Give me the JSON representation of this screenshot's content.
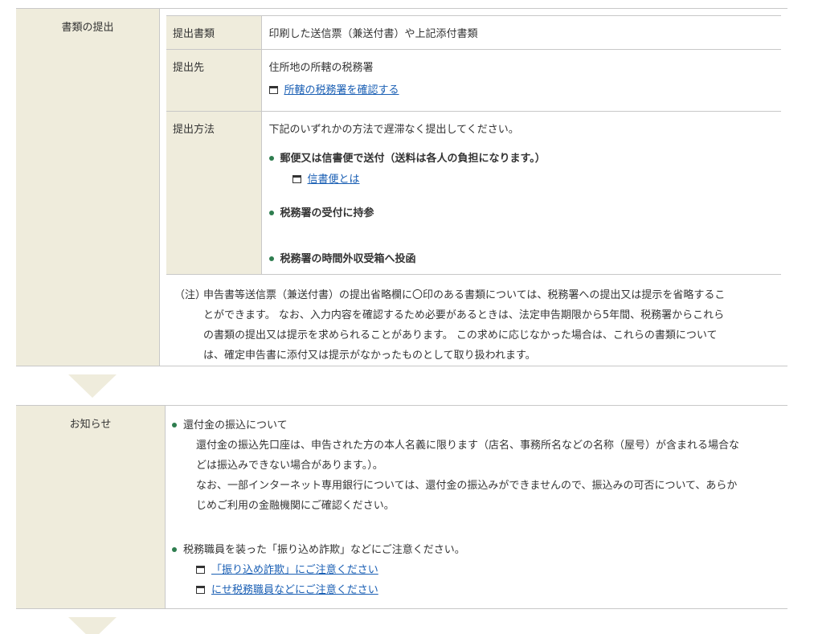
{
  "submission": {
    "heading": "書類の提出",
    "rows": {
      "documents": {
        "label": "提出書類",
        "value": "印刷した送信票（兼送付書）や上記添付書類"
      },
      "destination": {
        "label": "提出先",
        "value": "住所地の所轄の税務署",
        "link": "所轄の税務署を確認する"
      },
      "method": {
        "label": "提出方法",
        "intro": "下記のいずれかの方法で遅滞なく提出してください。",
        "options": [
          {
            "text": "郵便又は信書便で送付（送料は各人の負担になります。）",
            "link": "信書便とは"
          },
          {
            "text": "税務署の受付に持参"
          },
          {
            "text": "税務署の時間外収受箱へ投函"
          }
        ]
      }
    },
    "note_mark": "（注）",
    "note_lines": [
      "申告書等送信票（兼送付書）の提出省略欄に〇印のある書類については、税務署への提出又は提示を省略するこ",
      "とができます。 なお、入力内容を確認するため必要があるときは、法定申告期限から5年間、税務署からこれら",
      "の書類の提出又は提示を求められることがあります。 この求めに応じなかった場合は、これらの書類について",
      "は、確定申告書に添付又は提示がなかったものとして取り扱われます。"
    ]
  },
  "notice": {
    "heading": "お知らせ",
    "items": [
      {
        "title": "還付金の振込について",
        "lines": [
          "還付金の振込先口座は、申告された方の本人名義に限ります（店名、事務所名などの名称（屋号）が含まれる場合な",
          "どは振込みできない場合があります。）。",
          "なお、一部インターネット専用銀行については、還付金の振込みができませんので、振込みの可否について、あらか",
          "じめご利用の金融機関にご確認ください。"
        ]
      },
      {
        "title": "税務職員を装った「振り込め詐欺」などにご注意ください。",
        "links": [
          "「振り込め詐欺」にご注意ください",
          "にせ税務職員などにご注意ください"
        ]
      }
    ]
  },
  "colors": {
    "header_bg": "#efecdc",
    "border": "#c8c8c8",
    "link": "#1a5fb4",
    "bullet": "#2e7d4f"
  }
}
